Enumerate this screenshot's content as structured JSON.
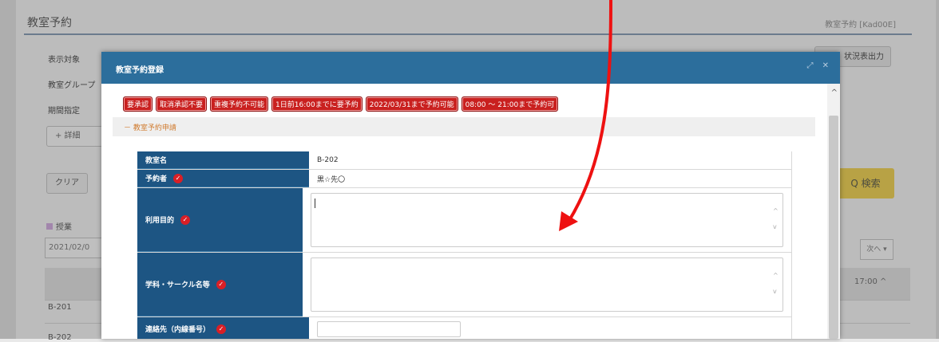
{
  "page": {
    "title": "教室予約",
    "code": "教室予約 [Kad00E]",
    "labels": [
      "表示対象",
      "教室グループ",
      "期間指定"
    ],
    "detail_btn": "+ 詳細",
    "clear_btn": "クリア",
    "search_btn": "Q 検索",
    "csv_btn": "状況表出力",
    "legend": "授業",
    "date": "2021/02/0",
    "page_select": "次へ ▾",
    "time": "17:00",
    "rooms": [
      "B-201",
      "B-202"
    ]
  },
  "modal": {
    "title": "教室予約登録",
    "controls": "⤢ ✕",
    "badges": [
      "要承認",
      "取消承認不要",
      "重複予約不可能",
      "1日前16:00までに要予約",
      "2022/03/31まで予約可能",
      "08:00 ～ 21:00まで予約可"
    ],
    "section": "－ 教室予約申請",
    "form": {
      "room_label": "教室名",
      "room_value": "B-202",
      "reserver_label": "予約者",
      "reserver_value": "黒☆先〇",
      "purpose_label": "利用目的",
      "circle_label": "学科・サークル名等",
      "contact_label": "連絡先（内線番号）"
    }
  },
  "colors": {
    "header_blue": "#2c6e9c",
    "label_blue": "#1d5583",
    "badge_red": "#c9201f",
    "required_red": "#d91f26",
    "search_yellow": "#f6d85d"
  }
}
